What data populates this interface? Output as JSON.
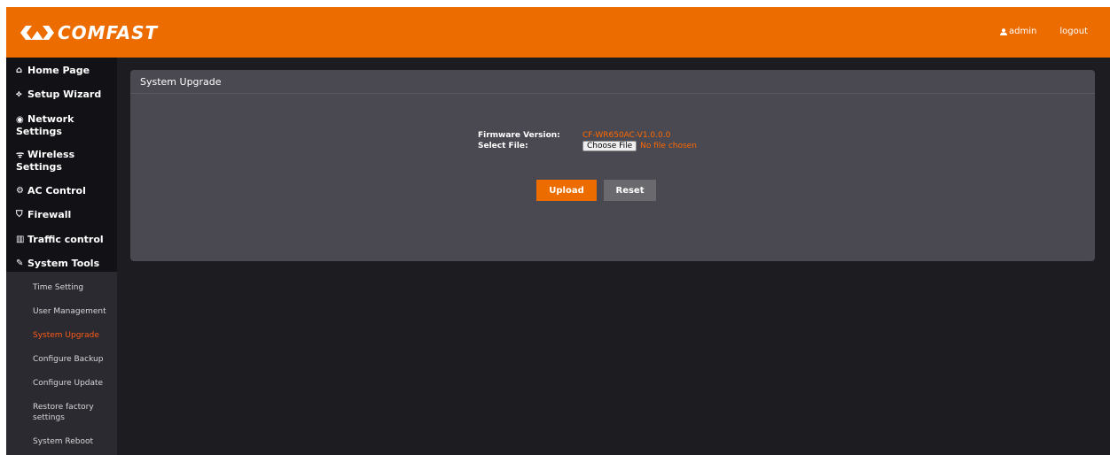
{
  "header": {
    "brand": "COMFAST",
    "user_label": "admin",
    "logout_label": "logout",
    "accent_color": "#ec6c00"
  },
  "sidebar": {
    "items": [
      {
        "label": "Home Page",
        "icon": "home-icon"
      },
      {
        "label": "Setup Wizard",
        "icon": "wand-icon"
      },
      {
        "label": "Network Settings",
        "icon": "globe-icon"
      },
      {
        "label": "Wireless Settings",
        "icon": "wifi-icon"
      },
      {
        "label": "AC Control",
        "icon": "gear-icon"
      },
      {
        "label": "Firewall",
        "icon": "shield-icon"
      },
      {
        "label": "Traffic control",
        "icon": "bar-chart-icon"
      },
      {
        "label": "System Tools",
        "icon": "tools-icon"
      }
    ],
    "subitems": [
      {
        "label": "Time Setting",
        "active": false
      },
      {
        "label": "User Management",
        "active": false
      },
      {
        "label": "System Upgrade",
        "active": true
      },
      {
        "label": "Configure Backup",
        "active": false
      },
      {
        "label": "Configure Update",
        "active": false
      },
      {
        "label": "Restore factory settings",
        "active": false
      },
      {
        "label": "System Reboot",
        "active": false
      }
    ]
  },
  "panel": {
    "title": "System Upgrade",
    "firmware_label": "Firmware Version:",
    "firmware_value": "CF-WR650AC-V1.0.0.0",
    "file_label": "Select File:",
    "choose_file_label": "Choose File",
    "file_status": "No file chosen",
    "upload_label": "Upload",
    "reset_label": "Reset"
  }
}
